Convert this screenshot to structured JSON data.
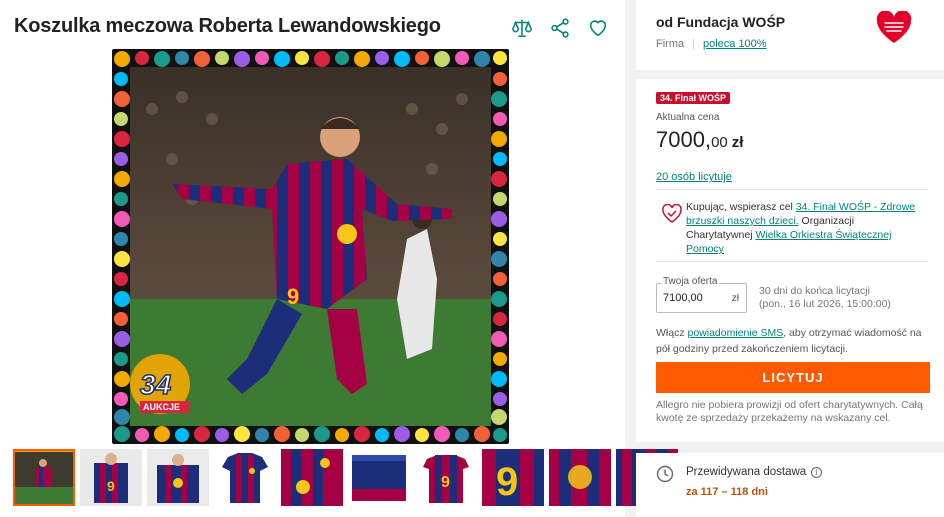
{
  "product": {
    "title": "Koszulka meczowa Roberta Lewandowskiego",
    "icons": [
      "compare-icon",
      "share-icon",
      "heart-icon"
    ]
  },
  "gallery": {
    "overlay_number": "34",
    "overlay_tag": "AUKCJE",
    "thumbnail_count": 10,
    "jersey_number": "9"
  },
  "seller": {
    "name": "od Fundacja WOŚP",
    "type": "Firma",
    "recommendation": "poleca 100%",
    "logo_icon": "wosp-heart-logo"
  },
  "offer": {
    "badge": "34. Finał WOŚP",
    "price_label": "Aktualna cena",
    "price_main": "7000,",
    "price_decimal": "00",
    "currency": "zł",
    "bidders": "20 osób licytuje",
    "support_prefix": "Kupując, wspierasz cel ",
    "support_goal": "34. Finał WOŚP - Zdrowe brzuszki naszych dzieci.",
    "support_org_prefix": " Organizacji Charytatywnej ",
    "support_org": "Wielka Orkiestra Świątecznej Pomocy",
    "bid_legend": "Twoja oferta",
    "bid_value": "7100,00",
    "bid_unit": "zł",
    "countdown_line1": "30 dni do końca licytacji",
    "countdown_line2": "(pon., 16 lut 2026, 15:00:00)",
    "notify_prefix": "Włącz ",
    "notify_link": "powiadomienie SMS",
    "notify_suffix": ", aby otrzymać wiadomość na pół godziny przed zakończeniem licytacji.",
    "bid_button": "LICYTUJ",
    "disclaimer": "Allegro nie pobiera prowizji od ofert charytatywnych. Całą kwotę ze sprzedaży przekażemy na wskazany cel."
  },
  "delivery": {
    "label": "Przewidywana dostawa",
    "range": "za 117 – 118 dni"
  },
  "colors": {
    "accent": "#00857a",
    "cta": "#ff5a00",
    "badge": "#c8102e",
    "barca_blue": "#1c2d7a",
    "barca_red": "#a50044"
  }
}
